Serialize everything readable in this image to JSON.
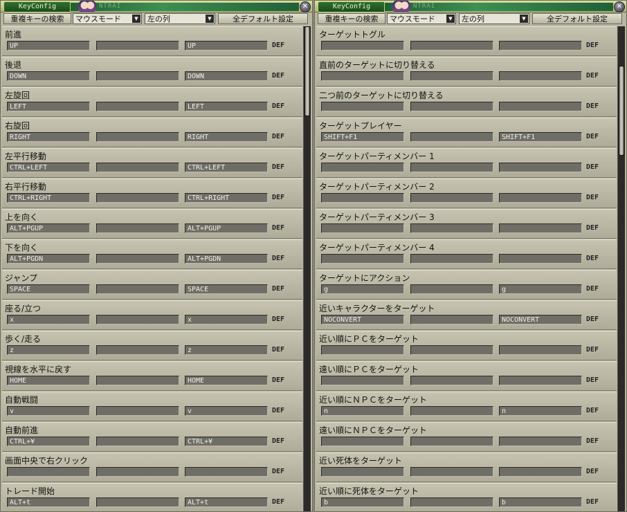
{
  "window_title": "KeyConfig",
  "title_faint": "NTRAI",
  "toolbar": {
    "dup_search": "重複キーの検索",
    "mode_select": "マウスモード",
    "column_select": "左の列",
    "all_default": "全デフォルト設定"
  },
  "def_label": "DEF",
  "left_panel": {
    "scroll_fraction": 0.0,
    "entries": [
      {
        "label": "前進",
        "key1": "UP",
        "key2": "",
        "key3": "UP"
      },
      {
        "label": "後退",
        "key1": "DOWN",
        "key2": "",
        "key3": "DOWN"
      },
      {
        "label": "左旋回",
        "key1": "LEFT",
        "key2": "",
        "key3": "LEFT"
      },
      {
        "label": "右旋回",
        "key1": "RIGHT",
        "key2": "",
        "key3": "RIGHT"
      },
      {
        "label": "左平行移動",
        "key1": "CTRL+LEFT",
        "key2": "",
        "key3": "CTRL+LEFT"
      },
      {
        "label": "右平行移動",
        "key1": "CTRL+RIGHT",
        "key2": "",
        "key3": "CTRL+RIGHT"
      },
      {
        "label": "上を向く",
        "key1": "ALT+PGUP",
        "key2": "",
        "key3": "ALT+PGUP"
      },
      {
        "label": "下を向く",
        "key1": "ALT+PGDN",
        "key2": "",
        "key3": "ALT+PGDN"
      },
      {
        "label": "ジャンプ",
        "key1": "SPACE",
        "key2": "",
        "key3": "SPACE"
      },
      {
        "label": "座る/立つ",
        "key1": "x",
        "key2": "",
        "key3": "x"
      },
      {
        "label": "歩く/走る",
        "key1": "z",
        "key2": "",
        "key3": "z"
      },
      {
        "label": "視線を水平に戻す",
        "key1": "HOME",
        "key2": "",
        "key3": "HOME"
      },
      {
        "label": "自動戦闘",
        "key1": "v",
        "key2": "",
        "key3": "v"
      },
      {
        "label": "自動前進",
        "key1": "CTRL+¥",
        "key2": "",
        "key3": "CTRL+¥"
      },
      {
        "label": "画面中央で右クリック",
        "key1": "",
        "key2": "",
        "key3": ""
      },
      {
        "label": "トレード開始",
        "key1": "ALT+t",
        "key2": "",
        "key3": "ALT+t"
      }
    ]
  },
  "right_panel": {
    "scroll_fraction": 0.1,
    "entries": [
      {
        "label": "ターゲットトグル",
        "key1": "",
        "key2": "",
        "key3": ""
      },
      {
        "label": "直前のターゲットに切り替える",
        "key1": "",
        "key2": "",
        "key3": ""
      },
      {
        "label": "二つ前のターゲットに切り替える",
        "key1": "",
        "key2": "",
        "key3": ""
      },
      {
        "label": "ターゲットプレイヤー",
        "key1": "SHIFT+F1",
        "key2": "",
        "key3": "SHIFT+F1"
      },
      {
        "label": "ターゲットパーティメンバー 1",
        "key1": "",
        "key2": "",
        "key3": ""
      },
      {
        "label": "ターゲットパーティメンバー 2",
        "key1": "",
        "key2": "",
        "key3": ""
      },
      {
        "label": "ターゲットパーティメンバー 3",
        "key1": "",
        "key2": "",
        "key3": ""
      },
      {
        "label": "ターゲットパーティメンバー 4",
        "key1": "",
        "key2": "",
        "key3": ""
      },
      {
        "label": "ターゲットにアクション",
        "key1": "g",
        "key2": "",
        "key3": "g"
      },
      {
        "label": "近いキャラクターをターゲット",
        "key1": "NOCONVERT",
        "key2": "",
        "key3": "NOCONVERT"
      },
      {
        "label": "近い順にＰＣをターゲット",
        "key1": "",
        "key2": "",
        "key3": ""
      },
      {
        "label": "遠い順にＰＣをターゲット",
        "key1": "",
        "key2": "",
        "key3": ""
      },
      {
        "label": "近い順にＮＰＣをターゲット",
        "key1": "n",
        "key2": "",
        "key3": "n"
      },
      {
        "label": "遠い順にＮＰＣをターゲット",
        "key1": "",
        "key2": "",
        "key3": ""
      },
      {
        "label": "近い死体をターゲット",
        "key1": "",
        "key2": "",
        "key3": ""
      },
      {
        "label": "近い順に死体をターゲット",
        "key1": "b",
        "key2": "",
        "key3": "b"
      }
    ]
  }
}
